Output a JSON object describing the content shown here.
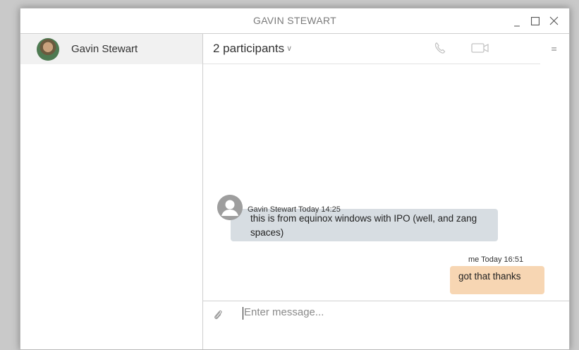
{
  "window": {
    "title": "GAVIN STEWART"
  },
  "sidebar": {
    "contacts": [
      {
        "name": "Gavin Stewart"
      }
    ]
  },
  "chat": {
    "participants_label": "2 participants",
    "icons": {
      "call": "phone-icon",
      "video": "video-camera-icon",
      "menu": "menu-icon",
      "attach": "paperclip-icon"
    },
    "messages": [
      {
        "sender": "Gavin Stewart",
        "time": "Today 14:25",
        "text": "this is from equinox windows with IPO (well, and zang spaces)",
        "direction": "incoming"
      },
      {
        "sender": "me",
        "time": "Today 16:51",
        "text": "got that thanks",
        "direction": "outgoing"
      }
    ],
    "composer": {
      "placeholder": "Enter message...",
      "value": ""
    }
  },
  "colors": {
    "incoming_bubble": "#d7dde2",
    "outgoing_bubble": "#f7d6b3",
    "selected_contact": "#f1f1f1"
  }
}
